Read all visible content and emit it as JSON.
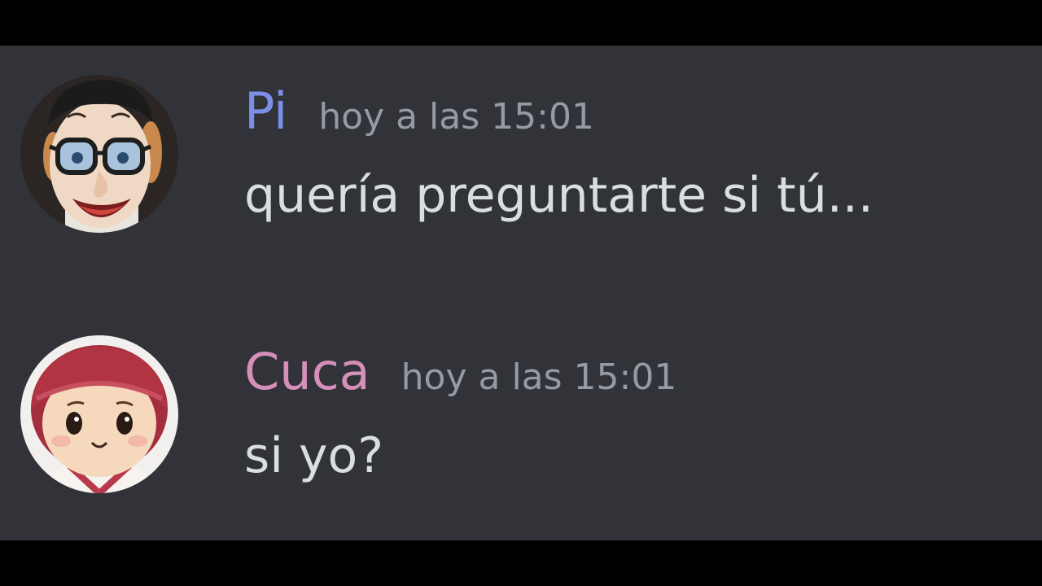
{
  "colors": {
    "background": "#313338",
    "letterbox": "#000000",
    "message_text": "#dbdee1",
    "timestamp_text": "#949ba4"
  },
  "messages": [
    {
      "author": "Pi",
      "author_color": "#7b8fe6",
      "timestamp": "hoy a las 15:01",
      "text": "quería preguntarte si tú...",
      "avatar_icon": "cartoon-man-glasses-avatar"
    },
    {
      "author": "Cuca",
      "author_color": "#d58fb8",
      "timestamp": "hoy a las 15:01",
      "text": "si yo?",
      "avatar_icon": "doll-red-hat-avatar"
    }
  ]
}
